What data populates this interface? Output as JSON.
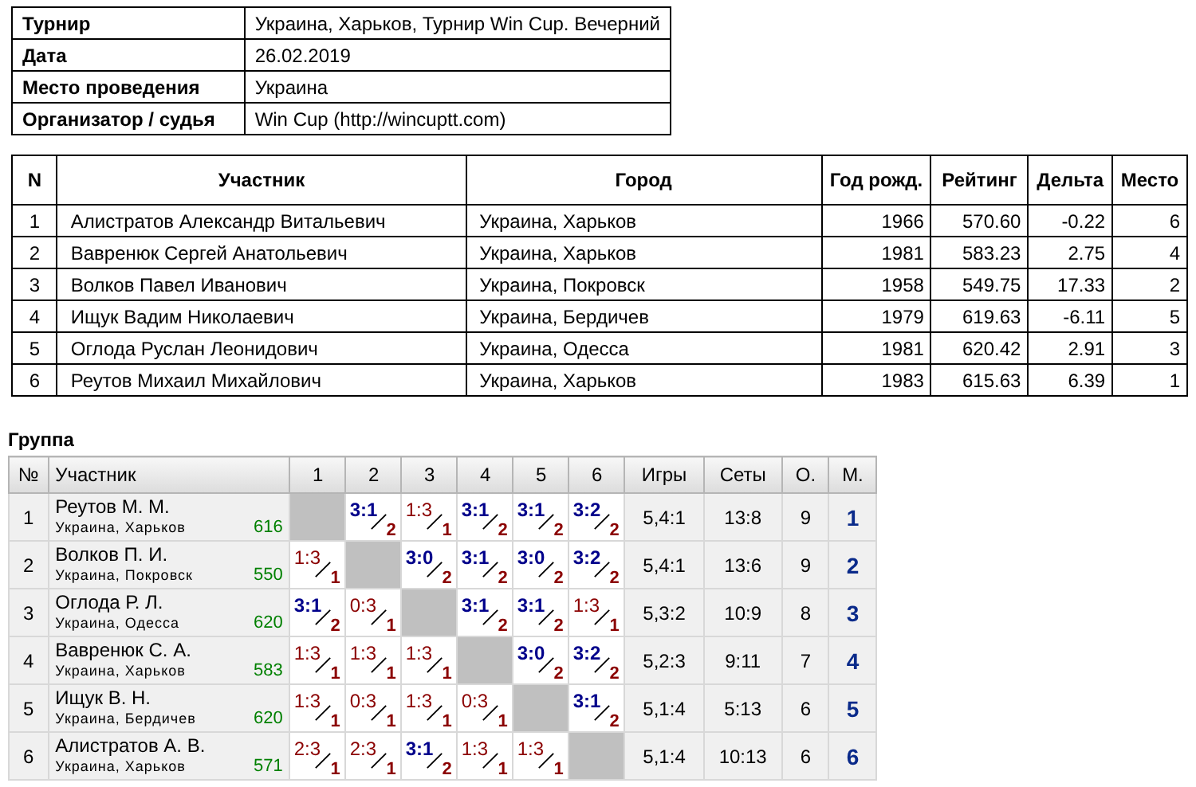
{
  "info": [
    {
      "label": "Турнир",
      "value": "Украина, Харьков, Турнир Win Cup. Вечерний"
    },
    {
      "label": "Дата",
      "value": "26.02.2019"
    },
    {
      "label": "Место проведения",
      "value": "Украина"
    },
    {
      "label": "Организатор / судья",
      "value": "Win Cup (http://wincuptt.com)"
    }
  ],
  "participants": {
    "columns": [
      "N",
      "Участник",
      "Город",
      "Год рожд.",
      "Рейтинг",
      "Дельта",
      "Место"
    ],
    "rows": [
      [
        "1",
        "Алистратов Александр Витальевич",
        "Украина, Харьков",
        "1966",
        "570.60",
        "-0.22",
        "6"
      ],
      [
        "2",
        "Вавренюк Сергей Анатольевич",
        "Украина, Харьков",
        "1981",
        "583.23",
        "2.75",
        "4"
      ],
      [
        "3",
        "Волков Павел Иванович",
        "Украина, Покровск",
        "1958",
        "549.75",
        "17.33",
        "2"
      ],
      [
        "4",
        "Ищук Вадим Николаевич",
        "Украина, Бердичев",
        "1979",
        "619.63",
        "-6.11",
        "5"
      ],
      [
        "5",
        "Оглода Руслан Леонидович",
        "Украина, Одесса",
        "1981",
        "620.42",
        "2.91",
        "3"
      ],
      [
        "6",
        "Реутов Михаил Михайлович",
        "Украина, Харьков",
        "1983",
        "615.63",
        "6.39",
        "1"
      ]
    ]
  },
  "group": {
    "title": "Группа",
    "columns": [
      "№",
      "Участник",
      "1",
      "2",
      "3",
      "4",
      "5",
      "6",
      "Игры",
      "Сеты",
      "О.",
      "М."
    ],
    "rows": [
      [
        {
          "kind": "number",
          "text": "1"
        },
        {
          "kind": "player",
          "name": "Реутов М. М.",
          "city": "Украина, Харьков",
          "rating": "616"
        },
        {
          "kind": "self"
        },
        {
          "kind": "win",
          "score": "3:1",
          "points": "2"
        },
        {
          "kind": "loss",
          "score": "1:3",
          "points": "1"
        },
        {
          "kind": "win",
          "score": "3:1",
          "points": "2"
        },
        {
          "kind": "win",
          "score": "3:1",
          "points": "2"
        },
        {
          "kind": "win",
          "score": "3:2",
          "points": "2"
        },
        {
          "kind": "stat",
          "text": "5,4:1"
        },
        {
          "kind": "stat",
          "text": "13:8"
        },
        {
          "kind": "stat",
          "text": "9"
        },
        {
          "kind": "place",
          "text": "1"
        }
      ],
      [
        {
          "kind": "number",
          "text": "2"
        },
        {
          "kind": "player",
          "name": "Волков П. И.",
          "city": "Украина, Покровск",
          "rating": "550"
        },
        {
          "kind": "loss",
          "score": "1:3",
          "points": "1"
        },
        {
          "kind": "self"
        },
        {
          "kind": "win",
          "score": "3:0",
          "points": "2"
        },
        {
          "kind": "win",
          "score": "3:1",
          "points": "2"
        },
        {
          "kind": "win",
          "score": "3:0",
          "points": "2"
        },
        {
          "kind": "win",
          "score": "3:2",
          "points": "2"
        },
        {
          "kind": "stat",
          "text": "5,4:1"
        },
        {
          "kind": "stat",
          "text": "13:6"
        },
        {
          "kind": "stat",
          "text": "9"
        },
        {
          "kind": "place",
          "text": "2"
        }
      ],
      [
        {
          "kind": "number",
          "text": "3"
        },
        {
          "kind": "player",
          "name": "Оглода Р. Л.",
          "city": "Украина, Одесса",
          "rating": "620"
        },
        {
          "kind": "win",
          "score": "3:1",
          "points": "2"
        },
        {
          "kind": "loss",
          "score": "0:3",
          "points": "1"
        },
        {
          "kind": "self"
        },
        {
          "kind": "win",
          "score": "3:1",
          "points": "2"
        },
        {
          "kind": "win",
          "score": "3:1",
          "points": "2"
        },
        {
          "kind": "loss",
          "score": "1:3",
          "points": "1"
        },
        {
          "kind": "stat",
          "text": "5,3:2"
        },
        {
          "kind": "stat",
          "text": "10:9"
        },
        {
          "kind": "stat",
          "text": "8"
        },
        {
          "kind": "place",
          "text": "3"
        }
      ],
      [
        {
          "kind": "number",
          "text": "4"
        },
        {
          "kind": "player",
          "name": "Вавренюк С. А.",
          "city": "Украина, Харьков",
          "rating": "583"
        },
        {
          "kind": "loss",
          "score": "1:3",
          "points": "1"
        },
        {
          "kind": "loss",
          "score": "1:3",
          "points": "1"
        },
        {
          "kind": "loss",
          "score": "1:3",
          "points": "1"
        },
        {
          "kind": "self"
        },
        {
          "kind": "win",
          "score": "3:0",
          "points": "2"
        },
        {
          "kind": "win",
          "score": "3:2",
          "points": "2"
        },
        {
          "kind": "stat",
          "text": "5,2:3"
        },
        {
          "kind": "stat",
          "text": "9:11"
        },
        {
          "kind": "stat",
          "text": "7"
        },
        {
          "kind": "place",
          "text": "4"
        }
      ],
      [
        {
          "kind": "number",
          "text": "5"
        },
        {
          "kind": "player",
          "name": "Ищук В. Н.",
          "city": "Украина, Бердичев",
          "rating": "620"
        },
        {
          "kind": "loss",
          "score": "1:3",
          "points": "1"
        },
        {
          "kind": "loss",
          "score": "0:3",
          "points": "1"
        },
        {
          "kind": "loss",
          "score": "1:3",
          "points": "1"
        },
        {
          "kind": "loss",
          "score": "0:3",
          "points": "1"
        },
        {
          "kind": "self"
        },
        {
          "kind": "win",
          "score": "3:1",
          "points": "2"
        },
        {
          "kind": "stat",
          "text": "5,1:4"
        },
        {
          "kind": "stat",
          "text": "5:13"
        },
        {
          "kind": "stat",
          "text": "6"
        },
        {
          "kind": "place",
          "text": "5"
        }
      ],
      [
        {
          "kind": "number",
          "text": "6"
        },
        {
          "kind": "player",
          "name": "Алистратов А. В.",
          "city": "Украина, Харьков",
          "rating": "571"
        },
        {
          "kind": "loss",
          "score": "2:3",
          "points": "1"
        },
        {
          "kind": "loss",
          "score": "2:3",
          "points": "1"
        },
        {
          "kind": "win",
          "score": "3:1",
          "points": "2"
        },
        {
          "kind": "loss",
          "score": "1:3",
          "points": "1"
        },
        {
          "kind": "loss",
          "score": "1:3",
          "points": "1"
        },
        {
          "kind": "self"
        },
        {
          "kind": "stat",
          "text": "5,1:4"
        },
        {
          "kind": "stat",
          "text": "10:13"
        },
        {
          "kind": "stat",
          "text": "6"
        },
        {
          "kind": "place",
          "text": "6"
        }
      ]
    ]
  }
}
